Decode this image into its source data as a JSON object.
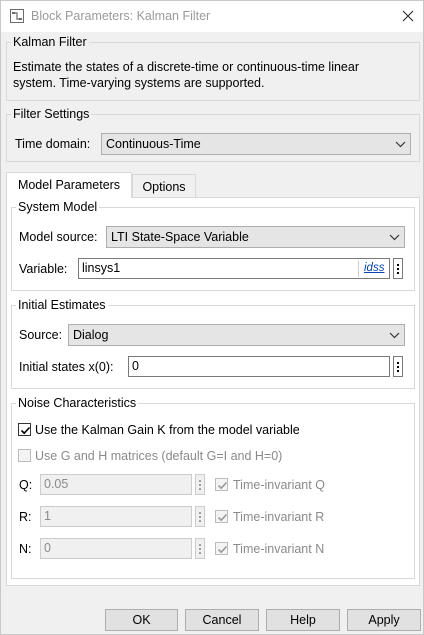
{
  "window": {
    "title": "Block Parameters: Kalman Filter",
    "app_icon": "simulink-icon",
    "close_icon": "close-icon"
  },
  "description": {
    "header": "Kalman Filter",
    "line1": "Estimate the states of a discrete-time or continuous-time linear",
    "line2": "system. Time-varying systems are supported."
  },
  "filter_settings": {
    "header": "Filter Settings",
    "time_domain_label": "Time domain:",
    "time_domain_value": "Continuous-Time"
  },
  "tabs": [
    {
      "label": "Model Parameters",
      "active": true
    },
    {
      "label": "Options",
      "active": false
    }
  ],
  "system_model": {
    "header": "System Model",
    "model_source_label": "Model source:",
    "model_source_value": "LTI State-Space Variable",
    "variable_label": "Variable:",
    "variable_value": "linsys1",
    "variable_link": "idss"
  },
  "initial_estimates": {
    "header": "Initial Estimates",
    "source_label": "Source:",
    "source_value": "Dialog",
    "initial_states_label": "Initial states x(0):",
    "initial_states_value": "0"
  },
  "noise": {
    "header": "Noise Characteristics",
    "use_kalman_gain_label": "Use the Kalman Gain K from the model variable",
    "use_kalman_gain_checked": true,
    "use_gh_label": "Use G and H matrices (default G=I and H=0)",
    "use_gh_checked": false,
    "rows": [
      {
        "label": "Q:",
        "value": "0.05",
        "timeinv_label": "Time-invariant Q",
        "checked": true
      },
      {
        "label": "R:",
        "value": "1",
        "timeinv_label": "Time-invariant R",
        "checked": true
      },
      {
        "label": "N:",
        "value": "0",
        "timeinv_label": "Time-invariant N",
        "checked": true
      }
    ]
  },
  "buttons": {
    "ok": "OK",
    "cancel": "Cancel",
    "help": "Help",
    "apply": "Apply"
  }
}
